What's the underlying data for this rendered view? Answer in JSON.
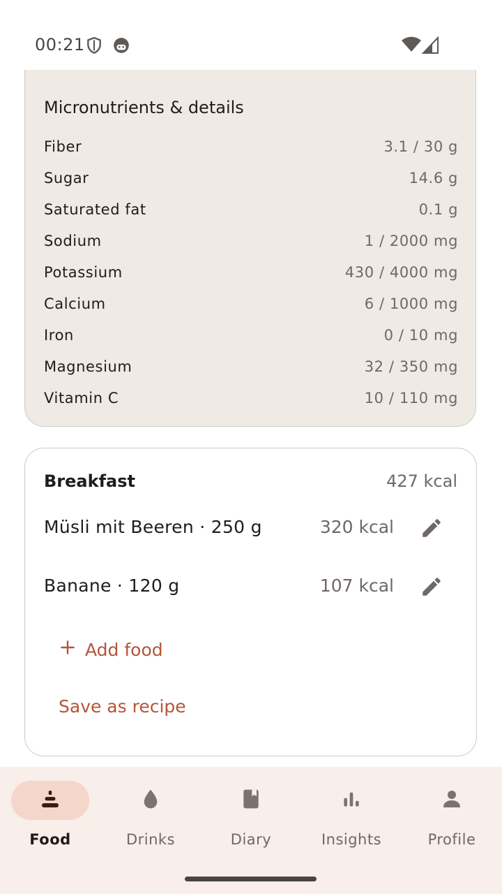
{
  "status_bar": {
    "time": "00:21",
    "left_icons": [
      "shield-icon",
      "android-face-icon"
    ],
    "right_icons": [
      "wifi-icon",
      "cell-signal-icon"
    ]
  },
  "micronutrients": {
    "title": "Micronutrients & details",
    "rows": [
      {
        "name": "Fiber",
        "value": "3.1 / 30 g"
      },
      {
        "name": "Sugar",
        "value": "14.6 g"
      },
      {
        "name": "Saturated fat",
        "value": "0.1 g"
      },
      {
        "name": "Sodium",
        "value": "1 / 2000 mg"
      },
      {
        "name": "Potassium",
        "value": "430 / 4000 mg"
      },
      {
        "name": "Calcium",
        "value": "6 / 1000 mg"
      },
      {
        "name": "Iron",
        "value": "0 / 10 mg"
      },
      {
        "name": "Magnesium",
        "value": "32 / 350 mg"
      },
      {
        "name": "Vitamin C",
        "value": "10 / 110 mg"
      }
    ]
  },
  "meal": {
    "title": "Breakfast",
    "total": "427 kcal",
    "items": [
      {
        "name": "Müsli mit Beeren · 250 g",
        "kcal": "320 kcal",
        "icon": "pencil-icon"
      },
      {
        "name": "Banane · 120 g",
        "kcal": "107 kcal",
        "icon": "pencil-icon"
      }
    ],
    "add_food_label": "Add food",
    "save_recipe_label": "Save as recipe"
  },
  "nav": {
    "items": [
      {
        "label": "Food",
        "icon": "food-stack-icon",
        "active": true
      },
      {
        "label": "Drinks",
        "icon": "water-drop-icon",
        "active": false
      },
      {
        "label": "Diary",
        "icon": "book-icon",
        "active": false
      },
      {
        "label": "Insights",
        "icon": "bar-chart-icon",
        "active": false
      },
      {
        "label": "Profile",
        "icon": "person-icon",
        "active": false
      }
    ]
  },
  "colors": {
    "accent": "#b4553a",
    "card_bg": "#efeae4",
    "nav_bg": "#f8eeea",
    "active_pill": "#f4d6cb"
  }
}
